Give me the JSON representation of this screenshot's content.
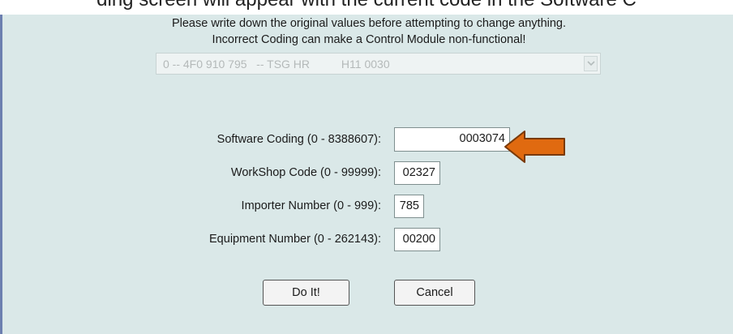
{
  "caption": "ding screen will appear with the current code in the Software C",
  "warning": {
    "line1": "Please write down the original values before attempting to change anything.",
    "line2": "Incorrect Coding can make a Control Module non-functional!"
  },
  "module_select": {
    "value": "0 -- 4F0 910 795   -- TSG HR          H11 0030",
    "enabled": false
  },
  "fields": {
    "software_coding": {
      "label": "Software Coding (0 - 8388607):",
      "value": "0003074"
    },
    "workshop_code": {
      "label": "WorkShop Code (0 - 99999):",
      "value": "02327"
    },
    "importer_number": {
      "label": "Importer Number (0 - 999):",
      "value": "785"
    },
    "equipment_number": {
      "label": "Equipment Number (0 - 262143):",
      "value": "00200"
    }
  },
  "buttons": {
    "do_it": "Do It!",
    "cancel": "Cancel"
  },
  "colors": {
    "panel_background": "#dae8e8",
    "annotation_arrow": "#e06a10"
  },
  "icons": {
    "annotation": "orange-left-arrow",
    "dropdown": "chevron-down"
  }
}
